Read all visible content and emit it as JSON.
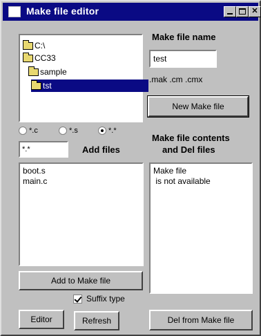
{
  "window": {
    "title": "Make file editor"
  },
  "titlebar_buttons": {
    "minimize_icon": "minimize-icon",
    "maximize_icon": "maximize-icon",
    "close_label": "✕"
  },
  "tree": {
    "items": [
      {
        "label": "C:\\",
        "icon": "folder-icon"
      },
      {
        "label": "CC33",
        "icon": "folder-open-icon"
      },
      {
        "label": "sample",
        "icon": "folder-open-icon"
      },
      {
        "label": "tst",
        "icon": "folder-open-icon",
        "selected": true
      }
    ]
  },
  "filters": [
    {
      "label": "*.c",
      "checked": false
    },
    {
      "label": "*.s",
      "checked": false
    },
    {
      "label": "*.*",
      "checked": true
    }
  ],
  "filter_input": {
    "value": "*.*"
  },
  "add_files_label": "Add files",
  "file_list": [
    "boot.s",
    "main.c"
  ],
  "add_button": "Add to Make file",
  "suffix_type": {
    "label": "Suffix type",
    "checked": true
  },
  "editor_button": "Editor",
  "refresh_button": "Refresh",
  "make_file_name_label": "Make file name",
  "make_file_name_value": "test",
  "extensions_text": ".mak .cm .cmx",
  "new_make_file_button": "New Make file",
  "contents_label_line1": "Make file contents",
  "contents_label_line2": "and Del files",
  "contents_lines": [
    "Make file",
    " is not available"
  ],
  "del_button": "Del from Make file"
}
